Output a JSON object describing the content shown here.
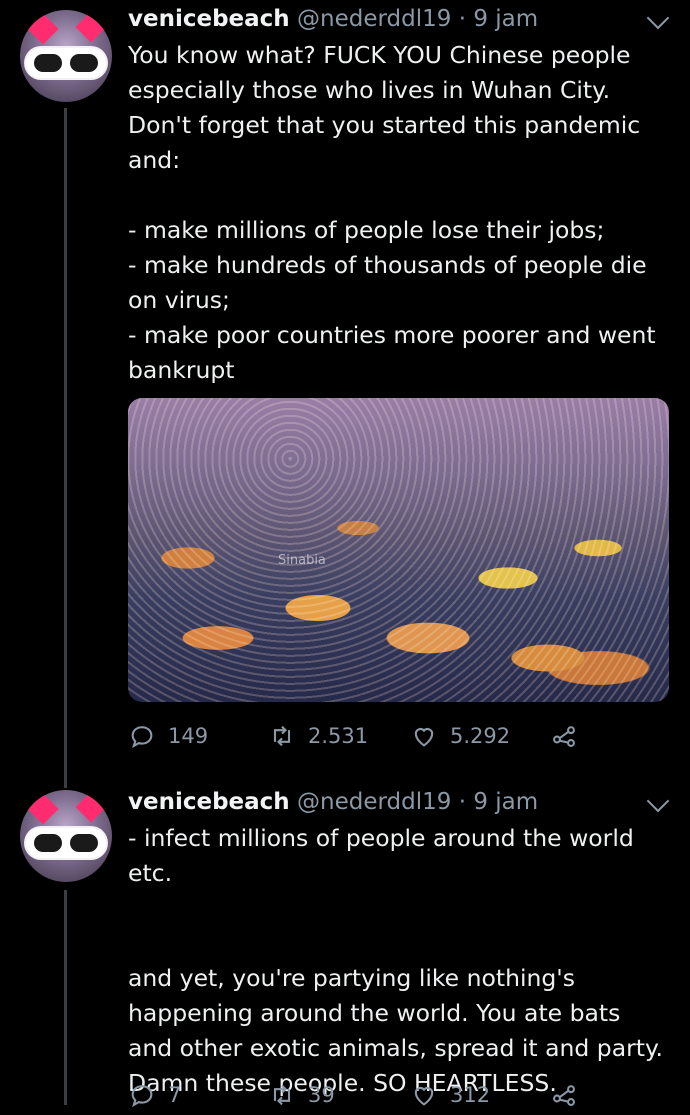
{
  "tweets": [
    {
      "display_name": "venicebeach",
      "handle": "@nederddl19",
      "time": "· 9 jam",
      "text": "You know what? FUCK YOU Chinese people\nespecially those who lives in Wuhan City.\nDon't forget that you started this pandemic\nand:\n\n- make millions of people lose their jobs;\n- make hundreds of thousands of people die\non virus;\n- make poor countries more poorer and went\nbankrupt",
      "media_watermark": "Sinabia",
      "stats": {
        "replies": "149",
        "retweets": "2.531",
        "likes": "5.292"
      }
    },
    {
      "display_name": "venicebeach",
      "handle": "@nederddl19",
      "time": "· 9 jam",
      "text": "- infect millions of people around the world\netc.\n\n\nand yet, you're partying like nothing's\nhappening around the world. You ate bats\nand other exotic animals, spread it and party.\nDamn these people. SO HEARTLESS.",
      "stats": {
        "replies": "7",
        "retweets": "39",
        "likes": "312"
      }
    }
  ],
  "icons": {
    "reply": "reply-icon",
    "retweet": "retweet-icon",
    "like": "heart-icon",
    "share": "share-icon",
    "more": "chevron-down-icon"
  },
  "colors": {
    "background": "#000000",
    "text": "#e7e9ea",
    "muted": "#8b98a5",
    "thread_line": "#3a3f44"
  }
}
